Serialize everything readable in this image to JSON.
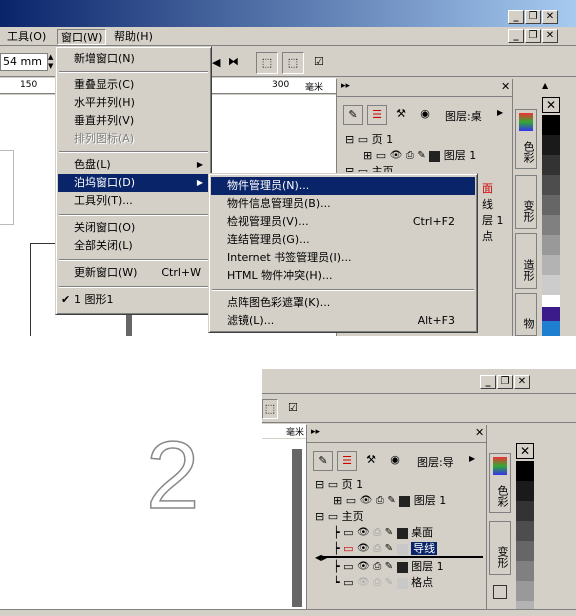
{
  "menubar": {
    "items": [
      {
        "label": "工具(O)"
      },
      {
        "label": "窗口(W)"
      },
      {
        "label": "帮助(H)"
      }
    ]
  },
  "toolbar": {
    "size_value": "54 mm",
    "ruler_marks": [
      "150",
      "300",
      "毫米"
    ]
  },
  "window_menu": {
    "items": [
      {
        "label": "新增窗口(N)"
      },
      {
        "label": "重叠显示(C)"
      },
      {
        "label": "水平并列(H)"
      },
      {
        "label": "垂直并列(V)"
      },
      {
        "label": "排列图标(A)"
      },
      {
        "label": "色盘(L)"
      },
      {
        "label": "泊坞窗口(D)"
      },
      {
        "label": "工具列(T)..."
      },
      {
        "label": "关闭窗口(O)"
      },
      {
        "label": "全部关闭(L)"
      },
      {
        "label": "更新窗口(W)",
        "shortcut": "Ctrl+W"
      },
      {
        "label": "1 图形1"
      }
    ]
  },
  "docker_submenu": {
    "items": [
      {
        "label": "物件管理员(N)..."
      },
      {
        "label": "物件信息管理员(B)..."
      },
      {
        "label": "检视管理员(V)...",
        "shortcut": "Ctrl+F2"
      },
      {
        "label": "连结管理员(G)..."
      },
      {
        "label": "Internet 书签管理员(I)..."
      },
      {
        "label": "HTML 物件冲突(H)..."
      },
      {
        "label": "点阵图色彩遮罩(K)..."
      },
      {
        "label": "滤镜(L)...",
        "shortcut": "Alt+F3"
      }
    ]
  },
  "panel_top": {
    "layer_label": "图层:桌",
    "tree": [
      {
        "label": "页 1"
      },
      {
        "label": "图层 1"
      },
      {
        "label": "主页"
      }
    ],
    "partial_labels": [
      "面",
      "线",
      "层 1",
      "点"
    ],
    "tabs": [
      "色彩",
      "变形",
      "造形",
      "物"
    ]
  },
  "big_number": "2",
  "panel_bottom": {
    "layer_label": "图层:导",
    "tree": [
      {
        "label": "页 1"
      },
      {
        "label": "图层 1"
      },
      {
        "label": "主页"
      },
      {
        "label": "桌面"
      },
      {
        "label": "导线"
      },
      {
        "label": "图层 1"
      },
      {
        "label": "格点"
      }
    ],
    "ruler": "毫米",
    "tabs": [
      "色彩",
      "变形"
    ]
  }
}
